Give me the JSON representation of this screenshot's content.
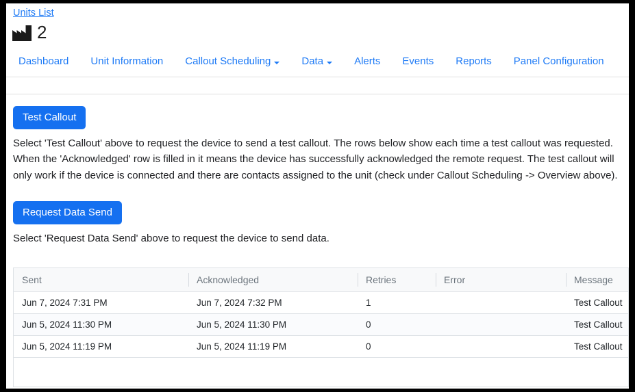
{
  "breadcrumb": {
    "label": "Units List"
  },
  "unit": {
    "icon": "factory-icon",
    "number": "2"
  },
  "nav": {
    "items": [
      {
        "label": "Dashboard",
        "has_caret": false
      },
      {
        "label": "Unit Information",
        "has_caret": false
      },
      {
        "label": "Callout Scheduling",
        "has_caret": true
      },
      {
        "label": "Data",
        "has_caret": true
      },
      {
        "label": "Alerts",
        "has_caret": false
      },
      {
        "label": "Events",
        "has_caret": false
      },
      {
        "label": "Reports",
        "has_caret": false
      },
      {
        "label": "Panel Configuration",
        "has_caret": false
      }
    ]
  },
  "actions": {
    "test_callout": {
      "button_label": "Test Callout",
      "description": "Select 'Test Callout' above to request the device to send a test callout. The rows below show each time a test callout was requested. When the 'Acknowledged' row is filled in it means the device has successfully acknowledged the remote request. The test callout will only work if the device is connected and there are contacts assigned to the unit (check under Callout Scheduling -> Overview above)."
    },
    "request_data_send": {
      "button_label": "Request Data Send",
      "description": "Select 'Request Data Send' above to request the device to send data."
    }
  },
  "table": {
    "columns": [
      "Sent",
      "Acknowledged",
      "Retries",
      "Error",
      "Message"
    ],
    "rows": [
      {
        "sent": "Jun 7, 2024 7:31 PM",
        "acknowledged": "Jun 7, 2024 7:32 PM",
        "retries": "1",
        "error": "",
        "message": "Test Callout"
      },
      {
        "sent": "Jun 5, 2024 11:30 PM",
        "acknowledged": "Jun 5, 2024 11:30 PM",
        "retries": "0",
        "error": "",
        "message": "Test Callout"
      },
      {
        "sent": "Jun 5, 2024 11:19 PM",
        "acknowledged": "Jun 5, 2024 11:19 PM",
        "retries": "0",
        "error": "",
        "message": "Test Callout"
      }
    ]
  },
  "colors": {
    "link": "#1f7bf6",
    "primary_button": "#1570f0",
    "table_header_bg": "#f8f9fa",
    "table_border": "#dee2e6"
  }
}
